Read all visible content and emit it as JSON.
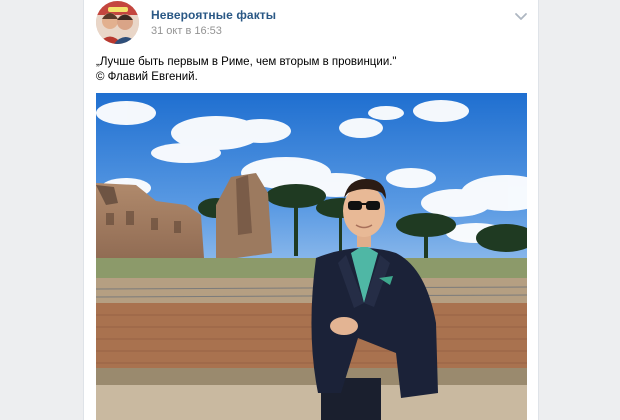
{
  "post": {
    "author": "Невероятные факты",
    "date": "31 окт в 16:53",
    "text_line1": "„Лучше быть первым в Риме, чем вторым в провинции.\"",
    "text_line2": "© Флавий Евгений.",
    "avatar_icon": "group-avatar",
    "menu_icon": "chevron-down-icon",
    "photo_icon": "photo-man-in-rome-ruins"
  },
  "colors": {
    "link": "#2a5885",
    "meta": "#939393",
    "page_bg": "#edeef0",
    "card_bg": "#ffffff"
  }
}
